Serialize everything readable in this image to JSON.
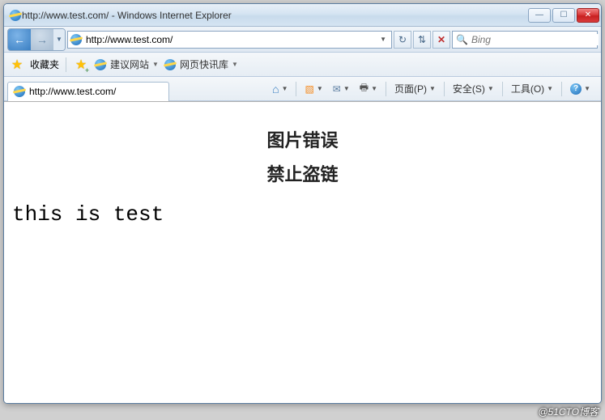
{
  "window": {
    "title": "http://www.test.com/ - Windows Internet Explorer"
  },
  "nav": {
    "url": "http://www.test.com/"
  },
  "search": {
    "placeholder": "Bing"
  },
  "favbar": {
    "label": "收藏夹",
    "link1": "建议网站",
    "link2": "网页快讯库"
  },
  "tab": {
    "title": "http://www.test.com/"
  },
  "commands": {
    "page": "页面(P)",
    "safety": "安全(S)",
    "tools": "工具(O)"
  },
  "page": {
    "err_line1": "图片错误",
    "err_line2": "禁止盗链",
    "body": "this is test"
  },
  "watermark": "@51CTO博客"
}
